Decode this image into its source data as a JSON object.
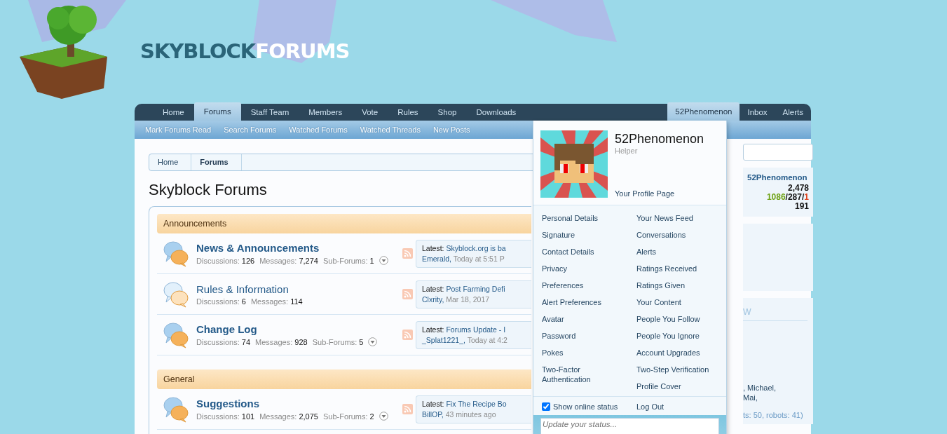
{
  "logo": {
    "part_1": "SKYBLOCK",
    "part_2": "FORUMS"
  },
  "nav": {
    "tabs": [
      {
        "label": "Home",
        "selected": false
      },
      {
        "label": "Forums",
        "selected": true
      },
      {
        "label": "Staff Team",
        "selected": false
      },
      {
        "label": "Members",
        "selected": false
      },
      {
        "label": "Vote",
        "selected": false
      },
      {
        "label": "Rules",
        "selected": false
      },
      {
        "label": "Shop",
        "selected": false
      },
      {
        "label": "Downloads",
        "selected": false
      }
    ],
    "user_tabs": [
      {
        "label": "52Phenomenon",
        "selected": true
      },
      {
        "label": "Inbox",
        "selected": false
      },
      {
        "label": "Alerts",
        "selected": false
      }
    ]
  },
  "subnav": [
    "Mark Forums Read",
    "Search Forums",
    "Watched Forums",
    "Watched Threads",
    "New Posts"
  ],
  "breadcrumb": [
    "Home",
    "Forums"
  ],
  "page_title": "Skyblock Forums",
  "categories": [
    {
      "title": "Announcements",
      "forums": [
        {
          "title": "News & Announcements",
          "unread": true,
          "stats": [
            {
              "label": "Discussions:",
              "value": "126"
            },
            {
              "label": "Messages:",
              "value": "7,274"
            }
          ],
          "sub_forums": {
            "label": "Sub-Forums:",
            "value": "1"
          },
          "latest": {
            "label": "Latest:",
            "title": "Skyblock.org is ba",
            "author": "Emerald,",
            "time": "Today at 5:51 P"
          }
        },
        {
          "title": "Rules & Information",
          "unread": false,
          "stats": [
            {
              "label": "Discussions:",
              "value": "6"
            },
            {
              "label": "Messages:",
              "value": "114"
            }
          ],
          "latest": {
            "label": "Latest:",
            "title": "Post Farming Defi",
            "author": "Clxrity,",
            "time": "Mar 18, 2017"
          }
        },
        {
          "title": "Change Log",
          "unread": true,
          "stats": [
            {
              "label": "Discussions:",
              "value": "74"
            },
            {
              "label": "Messages:",
              "value": "928"
            }
          ],
          "sub_forums": {
            "label": "Sub-Forums:",
            "value": "5"
          },
          "latest": {
            "label": "Latest:",
            "title": "Forums Update - I",
            "author": "_Splat1221_,",
            "time": "Today at 4:2"
          }
        }
      ]
    },
    {
      "title": "General",
      "forums": [
        {
          "title": "Suggestions",
          "unread": true,
          "stats": [
            {
              "label": "Discussions:",
              "value": "101"
            },
            {
              "label": "Messages:",
              "value": "2,075"
            }
          ],
          "sub_forums": {
            "label": "Sub-Forums:",
            "value": "2"
          },
          "latest": {
            "label": "Latest:",
            "title": "Fix The Recipe Bo",
            "author": "BillOP,",
            "time": "43 minutes ago"
          }
        }
      ]
    }
  ],
  "sidebar": {
    "profile": {
      "name": "52Phenomenon",
      "stats": [
        {
          "parts": [
            {
              "text": "2,478",
              "color": "#141414"
            }
          ]
        },
        {
          "parts": [
            {
              "text": "1086",
              "color": "#6fa215"
            },
            {
              "text": "/287/",
              "color": "#141414"
            },
            {
              "text": "1",
              "color": "#e0401a"
            }
          ]
        },
        {
          "parts": [
            {
              "text": "191",
              "color": "#141414"
            }
          ]
        }
      ]
    },
    "members_online": {
      "heading": "w",
      "lines": [
        ", Michael,",
        "Mai,"
      ],
      "footer": "ts: 50, robots: 41)"
    }
  },
  "user_menu": {
    "name": "52Phenomenon",
    "title": "Helper",
    "profile_link": "Your Profile Page",
    "left": [
      "Personal Details",
      "Signature",
      "Contact Details",
      "Privacy",
      "Preferences",
      "Alert Preferences",
      "Avatar",
      "Password",
      "Pokes",
      "Two-Factor Authentication"
    ],
    "right": [
      "Your News Feed",
      "Conversations",
      "Alerts",
      "Ratings Received",
      "Ratings Given",
      "Your Content",
      "People You Follow",
      "People You Ignore",
      "Account Upgrades",
      "Two-Step Verification",
      "Profile Cover"
    ],
    "online_status": {
      "label": "Show online status",
      "checked": true
    },
    "logout": "Log Out",
    "status_placeholder": "Update your status..."
  }
}
